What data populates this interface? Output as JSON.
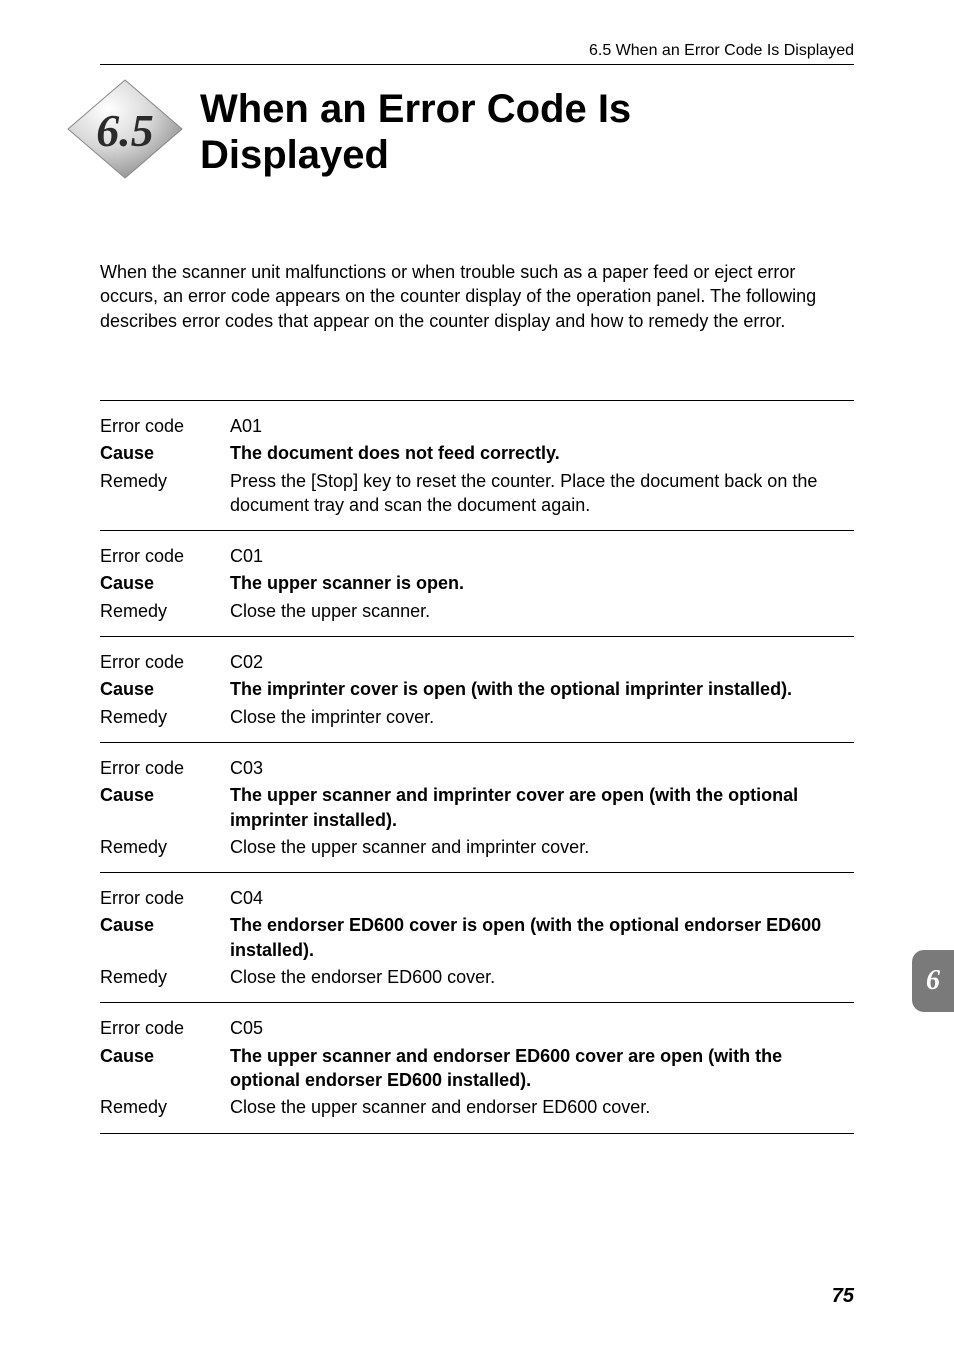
{
  "header": "6.5   When an Error Code Is Displayed",
  "section_number": "6.5",
  "section_title_line1": "When an Error Code Is",
  "section_title_line2": "Displayed",
  "intro": "When the scanner unit malfunctions or when trouble such as a paper feed or eject error occurs, an error code appears on the counter display of the operation panel. The following describes error codes that appear on the counter display and how to remedy the error.",
  "labels": {
    "error_code": "Error code",
    "cause": "Cause",
    "remedy": "Remedy"
  },
  "errors": [
    {
      "code": "A01",
      "cause": "The document does not feed correctly.",
      "remedy": "Press the [Stop] key to reset the counter. Place the document back on the document tray and scan the document again."
    },
    {
      "code": "C01",
      "cause": "The upper scanner is open.",
      "remedy": "Close the upper scanner."
    },
    {
      "code": "C02",
      "cause": "The imprinter cover is open (with the optional imprinter installed).",
      "remedy": "Close the imprinter cover."
    },
    {
      "code": "C03",
      "cause": "The upper scanner and imprinter cover are open (with the optional imprinter installed).",
      "remedy": "Close the upper scanner and imprinter cover."
    },
    {
      "code": "C04",
      "cause": "The endorser ED600 cover is open (with the optional endorser ED600 installed).",
      "remedy": "Close the endorser ED600 cover."
    },
    {
      "code": "C05",
      "cause": "The upper scanner and endorser ED600 cover are open (with the optional endorser ED600 installed).",
      "remedy": "Close the upper scanner and endorser ED600 cover."
    }
  ],
  "side_tab": "6",
  "page_number": "75"
}
